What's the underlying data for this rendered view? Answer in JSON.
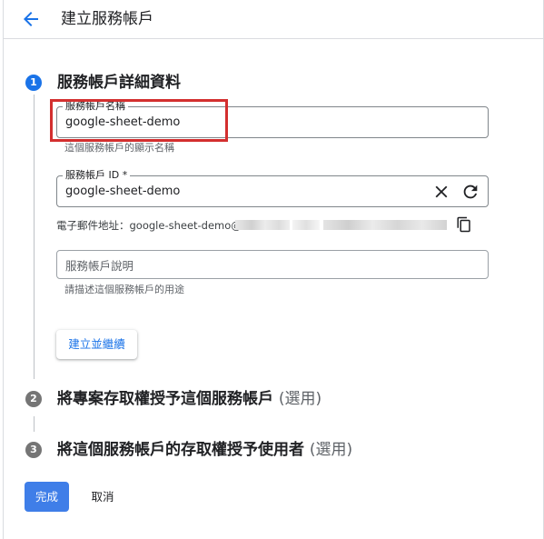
{
  "header": {
    "title": "建立服務帳戶"
  },
  "steps": [
    {
      "number": "1",
      "title": "服務帳戶詳細資料",
      "optional": ""
    },
    {
      "number": "2",
      "title": "將專案存取權授予這個服務帳戶",
      "optional": "(選用)"
    },
    {
      "number": "3",
      "title": "將這個服務帳戶的存取權授予使用者",
      "optional": "(選用)"
    }
  ],
  "form": {
    "account_name": {
      "label": "服務帳戶名稱",
      "value": "google-sheet-demo",
      "hint": "這個服務帳戶的顯示名稱"
    },
    "account_id": {
      "label": "服務帳戶 ID *",
      "value": "google-sheet-demo"
    },
    "email": {
      "prefix": "電子郵件地址：google-sheet-demo@"
    },
    "description": {
      "placeholder": "服務帳戶說明",
      "hint": "請描述這個服務帳戶的用途"
    }
  },
  "buttons": {
    "create_continue": "建立並繼續",
    "done": "完成",
    "cancel": "取消"
  },
  "colors": {
    "primary": "#1a73e8",
    "done_button": "#3f7ee8",
    "highlight": "#d32f2f"
  }
}
